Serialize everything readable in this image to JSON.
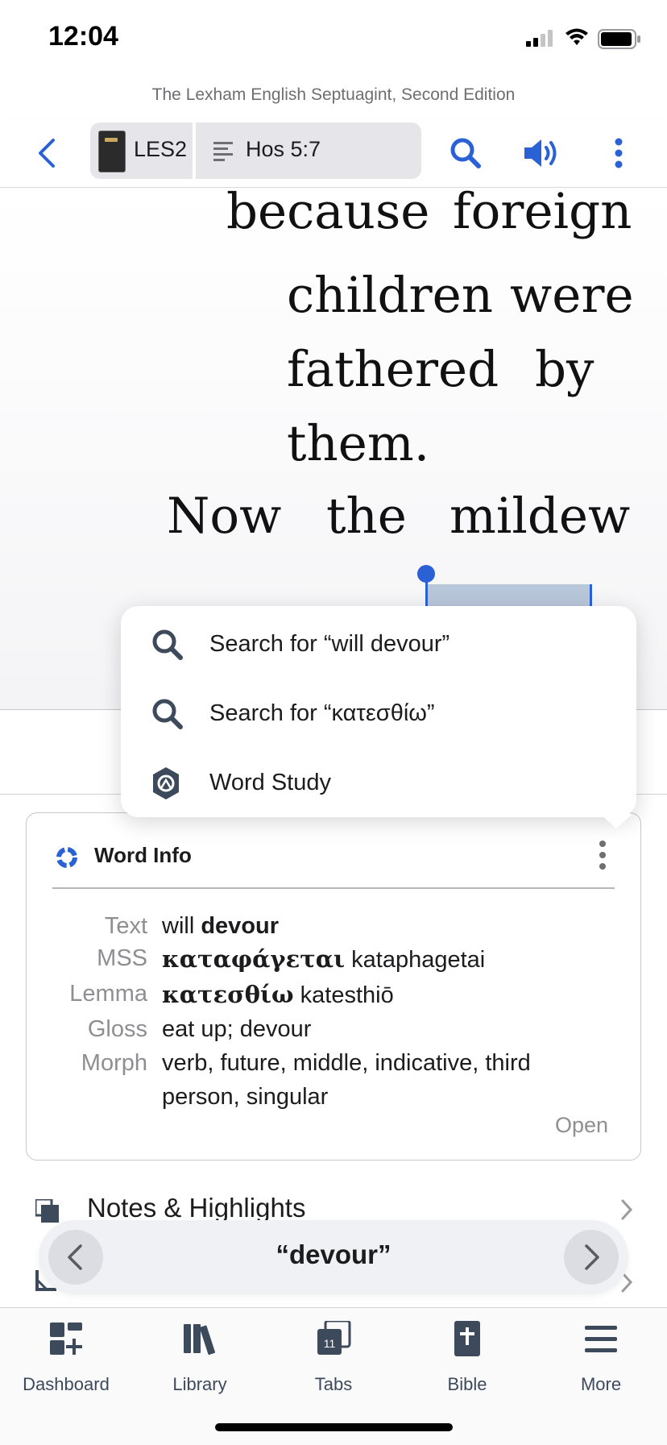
{
  "status_bar": {
    "time": "12:04"
  },
  "resource_title": "The Lexham English Septuagint, Second Edition",
  "toolbar": {
    "resource_abbrev": "LES2",
    "reference": "Hos 5:7"
  },
  "reader": {
    "lines": [
      [
        "because",
        "foreign"
      ],
      [
        "children",
        "were"
      ],
      [
        "fathered",
        "by"
      ],
      [
        "them."
      ],
      [
        "Now",
        "the",
        "mildew"
      ]
    ]
  },
  "context_menu": {
    "items": [
      {
        "label": "Search for “will devour”",
        "icon": "search-icon"
      },
      {
        "label": "Search for “κατεσθίω”",
        "icon": "search-icon"
      },
      {
        "label": "Word Study",
        "icon": "word-study-icon"
      }
    ]
  },
  "word_info": {
    "title": "Word Info",
    "rows": {
      "text": {
        "label": "Text",
        "plain": "will ",
        "bold": "devour"
      },
      "mss": {
        "label": "MSS",
        "bold": "καταφάγεται",
        "plain": " kataphagetai"
      },
      "lemma": {
        "label": "Lemma",
        "bold": "κατεσθίω",
        "plain": " katesthiō"
      },
      "gloss": {
        "label": "Gloss",
        "value": "eat up; devour"
      },
      "morph": {
        "label": "Morph",
        "line1": "verb, future, middle, indicative, third",
        "line2": "person, singular"
      }
    },
    "open_label": "Open"
  },
  "notes": {
    "label": "Notes & Highlights"
  },
  "search_nav": {
    "term": "“devour”"
  },
  "tab_bar": {
    "tabs": [
      {
        "label": "Dashboard",
        "icon": "dashboard-icon"
      },
      {
        "label": "Library",
        "icon": "library-icon"
      },
      {
        "label": "Tabs",
        "icon": "tabs-icon",
        "count": "11"
      },
      {
        "label": "Bible",
        "icon": "bible-icon"
      },
      {
        "label": "More",
        "icon": "menu-icon"
      }
    ]
  },
  "colors": {
    "accent": "#2a62d6",
    "selection": "#b9c7db",
    "tab_text": "#3c4a5c"
  }
}
